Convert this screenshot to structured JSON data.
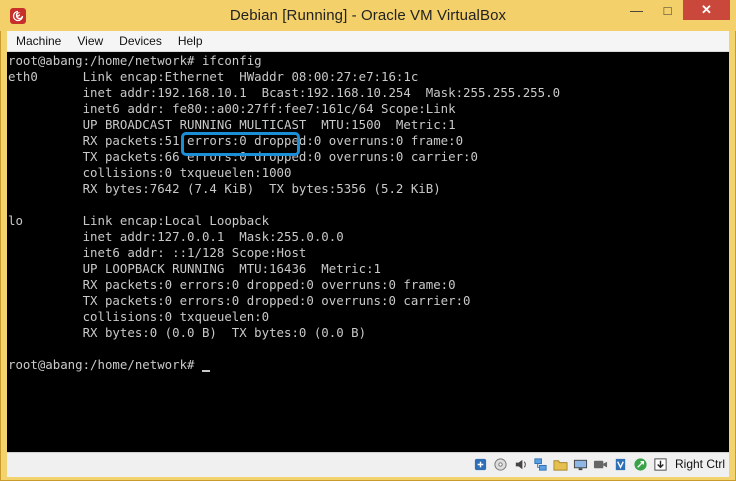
{
  "window": {
    "title": "Debian [Running] - Oracle VM VirtualBox",
    "controls": {
      "minimize": "—",
      "maximize": "□",
      "close": "✕"
    }
  },
  "menu": {
    "items": [
      "Machine",
      "View",
      "Devices",
      "Help"
    ]
  },
  "terminal": {
    "lines": [
      "root@abang:/home/network# ifconfig",
      "eth0      Link encap:Ethernet  HWaddr 08:00:27:e7:16:1c",
      "          inet addr:192.168.10.1  Bcast:192.168.10.254  Mask:255.255.255.0",
      "          inet6 addr: fe80::a00:27ff:fee7:161c/64 Scope:Link",
      "          UP BROADCAST RUNNING MULTICAST  MTU:1500  Metric:1",
      "          RX packets:51 errors:0 dropped:0 overruns:0 frame:0",
      "          TX packets:66 errors:0 dropped:0 overruns:0 carrier:0",
      "          collisions:0 txqueuelen:1000",
      "          RX bytes:7642 (7.4 KiB)  TX bytes:5356 (5.2 KiB)",
      "",
      "lo        Link encap:Local Loopback",
      "          inet addr:127.0.0.1  Mask:255.0.0.0",
      "          inet6 addr: ::1/128 Scope:Host",
      "          UP LOOPBACK RUNNING  MTU:16436  Metric:1",
      "          RX packets:0 errors:0 dropped:0 overruns:0 frame:0",
      "          TX packets:0 errors:0 dropped:0 overruns:0 carrier:0",
      "          collisions:0 txqueuelen:0",
      "          RX bytes:0 (0.0 B)  TX bytes:0 (0.0 B)",
      "",
      "root@abang:/home/network# "
    ]
  },
  "status": {
    "host_key": "Right Ctrl",
    "icons": [
      "usb-icon",
      "optical-disk-icon",
      "audio-icon",
      "network-icon",
      "shared-folder-icon",
      "display-icon",
      "video-capture-icon",
      "virtualization-icon",
      "mouse-integration-icon",
      "keyboard-capture-icon"
    ]
  },
  "colors": {
    "titlebar": "#f4d06a",
    "terminal_bg": "#000000",
    "terminal_fg": "#c9c9c9",
    "highlight": "#1a8fd8",
    "close_button": "#c9473b"
  }
}
